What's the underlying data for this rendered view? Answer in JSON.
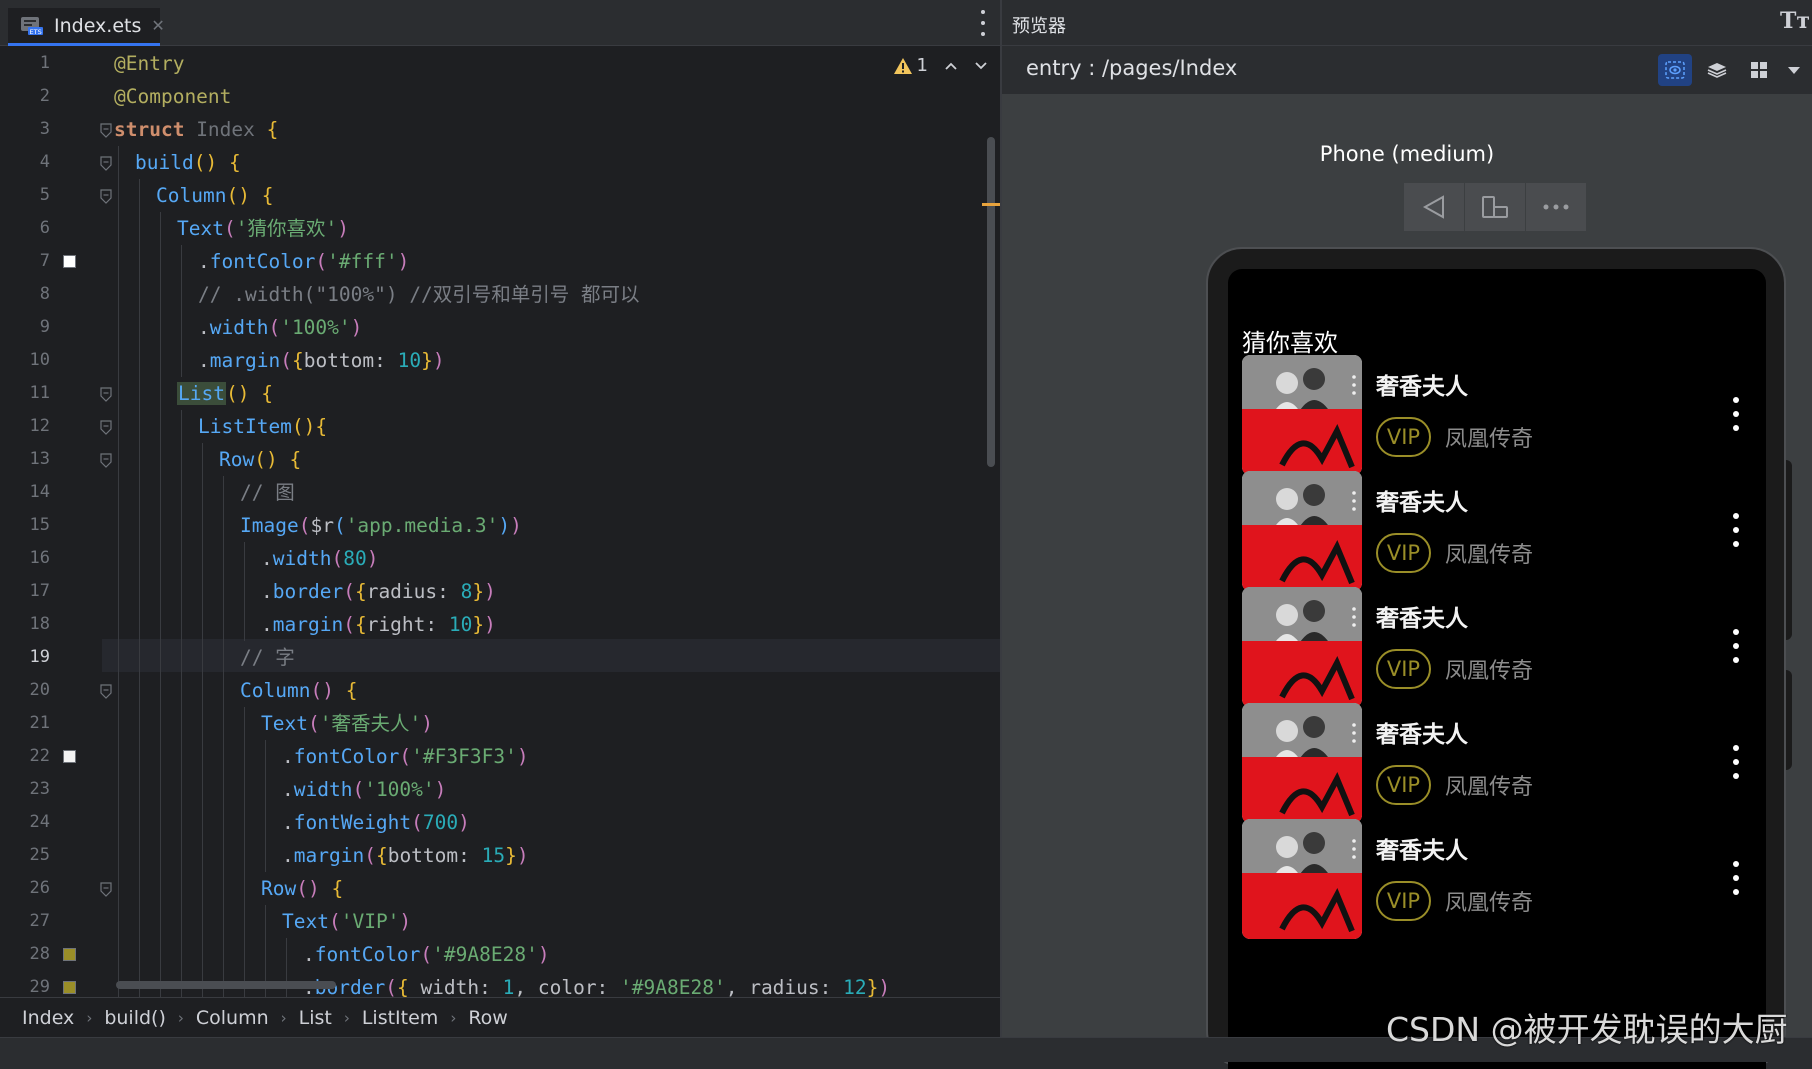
{
  "editor": {
    "tab": {
      "filename": "Index.ets",
      "icon": "ets-file-icon"
    },
    "warnings": {
      "count": "1"
    },
    "breadcrumb": [
      "Index",
      "build()",
      "Column",
      "List",
      "ListItem",
      "Row"
    ],
    "lines": [
      {
        "n": "1",
        "fold": false,
        "mark": null,
        "indent": 0,
        "tokens": [
          [
            "k-ann",
            "@Entry"
          ]
        ]
      },
      {
        "n": "2",
        "fold": false,
        "mark": null,
        "indent": 0,
        "tokens": [
          [
            "k-ann",
            "@Component"
          ]
        ]
      },
      {
        "n": "3",
        "fold": true,
        "mark": null,
        "indent": 0,
        "tokens": [
          [
            "k-kw",
            "struct "
          ],
          [
            "k-cls",
            "Index "
          ],
          [
            "k-br1",
            "{"
          ]
        ]
      },
      {
        "n": "4",
        "fold": true,
        "mark": null,
        "indent": 1,
        "tokens": [
          [
            "k-fn",
            "build"
          ],
          [
            "k-br1",
            "()"
          ],
          [
            "k-punc",
            " "
          ],
          [
            "k-br1",
            "{"
          ]
        ]
      },
      {
        "n": "5",
        "fold": true,
        "mark": null,
        "indent": 2,
        "tokens": [
          [
            "k-fn",
            "Column"
          ],
          [
            "k-br1",
            "()"
          ],
          [
            "k-punc",
            " "
          ],
          [
            "k-br1",
            "{"
          ]
        ]
      },
      {
        "n": "6",
        "fold": false,
        "mark": null,
        "indent": 3,
        "tokens": [
          [
            "k-fn",
            "Text"
          ],
          [
            "k-purple",
            "("
          ],
          [
            "k-str",
            "'猜你喜欢'"
          ],
          [
            "k-purple",
            ")"
          ]
        ]
      },
      {
        "n": "7",
        "fold": false,
        "mark": "#ffffff",
        "indent": 4,
        "tokens": [
          [
            "k-punc",
            "."
          ],
          [
            "k-fn",
            "fontColor"
          ],
          [
            "k-purple",
            "("
          ],
          [
            "k-str",
            "'#fff'"
          ],
          [
            "k-purple",
            ")"
          ]
        ]
      },
      {
        "n": "8",
        "fold": false,
        "mark": null,
        "indent": 4,
        "tokens": [
          [
            "k-cmt",
            "// .width(\"100%\") //双引号和单引号 都可以"
          ]
        ]
      },
      {
        "n": "9",
        "fold": false,
        "mark": null,
        "indent": 4,
        "tokens": [
          [
            "k-punc",
            "."
          ],
          [
            "k-fn",
            "width"
          ],
          [
            "k-purple",
            "("
          ],
          [
            "k-str",
            "'100%'"
          ],
          [
            "k-purple",
            ")"
          ]
        ]
      },
      {
        "n": "10",
        "fold": false,
        "mark": null,
        "indent": 4,
        "tokens": [
          [
            "k-punc",
            "."
          ],
          [
            "k-fn",
            "margin"
          ],
          [
            "k-purple",
            "("
          ],
          [
            "k-br1",
            "{"
          ],
          [
            "k-punc",
            "bottom: "
          ],
          [
            "k-num",
            "10"
          ],
          [
            "k-br1",
            "}"
          ],
          [
            "k-purple",
            ")"
          ]
        ]
      },
      {
        "n": "11",
        "fold": true,
        "mark": null,
        "indent": 3,
        "tokens": [
          [
            "list-hl k-fn",
            "List"
          ],
          [
            "k-br1",
            "()"
          ],
          [
            "k-punc",
            " "
          ],
          [
            "k-br1",
            "{"
          ]
        ]
      },
      {
        "n": "12",
        "fold": true,
        "mark": null,
        "indent": 4,
        "tokens": [
          [
            "k-fn",
            "ListItem"
          ],
          [
            "k-br1",
            "(){"
          ]
        ]
      },
      {
        "n": "13",
        "fold": true,
        "mark": null,
        "indent": 5,
        "tokens": [
          [
            "k-fn",
            "Row"
          ],
          [
            "k-br1",
            "()"
          ],
          [
            "k-punc",
            " "
          ],
          [
            "k-br1",
            "{"
          ]
        ]
      },
      {
        "n": "14",
        "fold": false,
        "mark": null,
        "indent": 6,
        "tokens": [
          [
            "k-cmt",
            "// 图"
          ]
        ]
      },
      {
        "n": "15",
        "fold": false,
        "mark": null,
        "indent": 6,
        "tokens": [
          [
            "k-fn",
            "Image"
          ],
          [
            "k-purple",
            "("
          ],
          [
            "k-punc",
            "$r"
          ],
          [
            "k-fn",
            "("
          ],
          [
            "k-str",
            "'app.media.3'"
          ],
          [
            "k-fn",
            ")"
          ],
          [
            "k-purple",
            ")"
          ]
        ]
      },
      {
        "n": "16",
        "fold": false,
        "mark": null,
        "indent": 7,
        "tokens": [
          [
            "k-punc",
            "."
          ],
          [
            "k-fn",
            "width"
          ],
          [
            "k-purple",
            "("
          ],
          [
            "k-num",
            "80"
          ],
          [
            "k-purple",
            ")"
          ]
        ]
      },
      {
        "n": "17",
        "fold": false,
        "mark": null,
        "indent": 7,
        "tokens": [
          [
            "k-punc",
            "."
          ],
          [
            "k-fn",
            "border"
          ],
          [
            "k-purple",
            "("
          ],
          [
            "k-br1",
            "{"
          ],
          [
            "k-punc",
            "radius: "
          ],
          [
            "k-num",
            "8"
          ],
          [
            "k-br1",
            "}"
          ],
          [
            "k-purple",
            ")"
          ]
        ]
      },
      {
        "n": "18",
        "fold": false,
        "mark": null,
        "indent": 7,
        "tokens": [
          [
            "k-punc",
            "."
          ],
          [
            "k-fn",
            "margin"
          ],
          [
            "k-purple",
            "("
          ],
          [
            "k-br1",
            "{"
          ],
          [
            "k-punc",
            "right: "
          ],
          [
            "k-num",
            "10"
          ],
          [
            "k-br1",
            "}"
          ],
          [
            "k-purple",
            ")"
          ]
        ]
      },
      {
        "n": "19",
        "fold": false,
        "mark": null,
        "indent": 6,
        "tokens": [
          [
            "k-cmt",
            "// 字"
          ]
        ],
        "current": true
      },
      {
        "n": "20",
        "fold": true,
        "mark": null,
        "indent": 6,
        "tokens": [
          [
            "k-fn",
            "Column"
          ],
          [
            "k-purple",
            "()"
          ],
          [
            "k-punc",
            " "
          ],
          [
            "k-br1",
            "{"
          ]
        ]
      },
      {
        "n": "21",
        "fold": false,
        "mark": null,
        "indent": 7,
        "tokens": [
          [
            "k-fn",
            "Text"
          ],
          [
            "k-purple",
            "("
          ],
          [
            "k-str",
            "'奢香夫人'"
          ],
          [
            "k-purple",
            ")"
          ]
        ]
      },
      {
        "n": "22",
        "fold": false,
        "mark": "#f3f3f3",
        "indent": 8,
        "tokens": [
          [
            "k-punc",
            "."
          ],
          [
            "k-fn",
            "fontColor"
          ],
          [
            "k-purple",
            "("
          ],
          [
            "k-str",
            "'#F3F3F3'"
          ],
          [
            "k-purple",
            ")"
          ]
        ]
      },
      {
        "n": "23",
        "fold": false,
        "mark": null,
        "indent": 8,
        "tokens": [
          [
            "k-punc",
            "."
          ],
          [
            "k-fn",
            "width"
          ],
          [
            "k-purple",
            "("
          ],
          [
            "k-str",
            "'100%'"
          ],
          [
            "k-purple",
            ")"
          ]
        ]
      },
      {
        "n": "24",
        "fold": false,
        "mark": null,
        "indent": 8,
        "tokens": [
          [
            "k-punc",
            "."
          ],
          [
            "k-fn",
            "fontWeight"
          ],
          [
            "k-purple",
            "("
          ],
          [
            "k-num",
            "700"
          ],
          [
            "k-purple",
            ")"
          ]
        ]
      },
      {
        "n": "25",
        "fold": false,
        "mark": null,
        "indent": 8,
        "tokens": [
          [
            "k-punc",
            "."
          ],
          [
            "k-fn",
            "margin"
          ],
          [
            "k-purple",
            "("
          ],
          [
            "k-br1",
            "{"
          ],
          [
            "k-punc",
            "bottom: "
          ],
          [
            "k-num",
            "15"
          ],
          [
            "k-br1",
            "}"
          ],
          [
            "k-purple",
            ")"
          ]
        ]
      },
      {
        "n": "26",
        "fold": true,
        "mark": null,
        "indent": 7,
        "tokens": [
          [
            "k-fn",
            "Row"
          ],
          [
            "k-purple",
            "()"
          ],
          [
            "k-punc",
            " "
          ],
          [
            "k-br1",
            "{"
          ]
        ]
      },
      {
        "n": "27",
        "fold": false,
        "mark": null,
        "indent": 8,
        "tokens": [
          [
            "k-fn",
            "Text"
          ],
          [
            "k-purple",
            "("
          ],
          [
            "k-str",
            "'VIP'"
          ],
          [
            "k-purple",
            ")"
          ]
        ]
      },
      {
        "n": "28",
        "fold": false,
        "mark": "#9a8e28",
        "indent": 9,
        "tokens": [
          [
            "k-punc",
            "."
          ],
          [
            "k-fn",
            "fontColor"
          ],
          [
            "k-purple",
            "("
          ],
          [
            "k-str",
            "'#9A8E28'"
          ],
          [
            "k-purple",
            ")"
          ]
        ]
      },
      {
        "n": "29",
        "fold": false,
        "mark": "#9a8e28",
        "indent": 9,
        "tokens": [
          [
            "k-punc",
            "."
          ],
          [
            "k-fn",
            "border"
          ],
          [
            "k-purple",
            "("
          ],
          [
            "k-br1",
            "{ "
          ],
          [
            "k-punc",
            "width: "
          ],
          [
            "k-num",
            "1"
          ],
          [
            "k-punc",
            ", color: "
          ],
          [
            "k-str",
            "'#9A8E28'"
          ],
          [
            "k-punc",
            ", radius: "
          ],
          [
            "k-num",
            "12"
          ],
          [
            "k-br1",
            "}"
          ],
          [
            "k-purple",
            ")"
          ]
        ]
      }
    ]
  },
  "preview": {
    "title": "预览器",
    "font_toggle": "Tт",
    "route": "entry : /pages/Index",
    "device_name": "Phone (medium)",
    "app": {
      "heading": "猜你喜欢",
      "songs": [
        {
          "title": "奢香夫人",
          "badge": "VIP",
          "artist": "凤凰传奇"
        },
        {
          "title": "奢香夫人",
          "badge": "VIP",
          "artist": "凤凰传奇"
        },
        {
          "title": "奢香夫人",
          "badge": "VIP",
          "artist": "凤凰传奇"
        },
        {
          "title": "奢香夫人",
          "badge": "VIP",
          "artist": "凤凰传奇"
        },
        {
          "title": "奢香夫人",
          "badge": "VIP",
          "artist": "凤凰传奇"
        }
      ]
    }
  },
  "watermark": "CSDN @被开发耽误的大厨",
  "colors": {
    "accent": "#3574f0",
    "vip": "#9a8e28",
    "background": "#1e1f22"
  }
}
